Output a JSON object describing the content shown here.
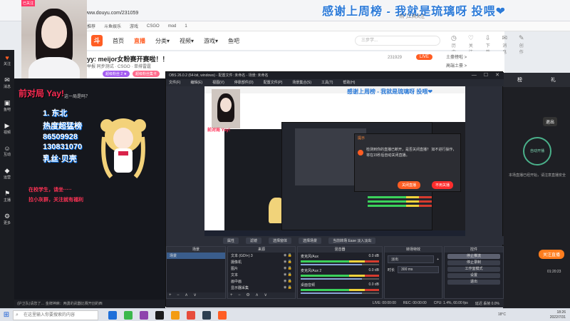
{
  "browser": {
    "url": "www.douyu.com/231059",
    "bookmarks": [
      "推荐",
      "斗鱼娱乐",
      "游戏",
      "CSGO",
      "mod",
      "1"
    ]
  },
  "banner": {
    "thanks_text": "感谢上周榜 - 我就是琉璃呀 投喂❤",
    "top_right_text": "热门工具关注"
  },
  "site": {
    "logo_text": "斗",
    "nav": [
      "首页",
      "直播",
      "分类▾",
      "视频▾",
      "游戏▾",
      "鱼吧"
    ],
    "active_nav_index": 1,
    "search_placeholder": "三步学...",
    "header_icons": [
      "历史",
      "关注",
      "下载",
      "消息",
      "创作"
    ]
  },
  "room": {
    "title": "yy: meijor女粉赛开赛啦！！",
    "subtitle": "举报  同步测试 · CSGO · 单排雷霆",
    "tags": [
      "超级粉丝 2 ★",
      "超级粉丝集卡"
    ],
    "room_id": "231929",
    "live_label": "LIVE",
    "webcam_badge": "已关注"
  },
  "gift_panel": {
    "items": [
      "土豪榜啦 >",
      "高端土豪 >"
    ]
  },
  "sidebar": {
    "items": [
      {
        "icon": "♥",
        "label": "关注",
        "icon_name": "heart-icon"
      },
      {
        "icon": "✉",
        "label": "消息",
        "icon_name": "mail-icon"
      },
      {
        "icon": "▣",
        "label": "鱼吧",
        "icon_name": "fishbar-icon"
      },
      {
        "icon": "▶",
        "label": "视频",
        "icon_name": "video-icon"
      },
      {
        "icon": "☺",
        "label": "互动",
        "icon_name": "smile-icon"
      },
      {
        "icon": "◆",
        "label": "运营",
        "icon_name": "diamond-icon"
      },
      {
        "icon": "⚑",
        "label": "主播",
        "icon_name": "flag-icon"
      },
      {
        "icon": "⚙",
        "label": "更多",
        "icon_name": "gear-icon"
      }
    ]
  },
  "stream": {
    "overlay_title": "前对局 Yay!",
    "question": "这一局是吗？",
    "ranking": [
      "1. 东北",
      "热度超猛榜",
      "86509928",
      "130831070",
      "乳丝·贝壳"
    ],
    "chat_lines": [
      "在校学生，请坐·····",
      "拉小灰群，关注就有福利"
    ],
    "bottom_bar": "(护卫队)请您了…  金牌神麻：两勇的武器比赛开创的西"
  },
  "right_panel": {
    "tab_left": "榜",
    "tab_right": "礼",
    "exit": "退出",
    "circle_label": "自动开播",
    "note": "本场直播已经开始，请注意直播安全",
    "live_button": "关注直播",
    "time": "01:20:23"
  },
  "obs": {
    "title": "OBS 26.0.2 (64-bit, windows) - 配置文件: 未命名 - 场景: 未命名",
    "menu": [
      "文件(F)",
      "编辑(E)",
      "视图(V)",
      "停靠部件(D)",
      "配置文件(P)",
      "场景集合(S)",
      "工具(T)",
      "帮助(H)"
    ],
    "win_controls": [
      "—",
      "☐",
      "✕"
    ],
    "preview": {
      "banner": "感谢上周榜 - 我就是琉璃呀 投喂❤",
      "red_text": "前对局 Yay!",
      "dialog_title": "提示",
      "dialog_text": "检测到你的直播已断开，是否关闭直播？ 如不进行操作，将在15秒后自动关闭直播。",
      "dialog_close_btn": "关闭直播",
      "dialog_noclose_btn": "不用关播"
    },
    "tabs": [
      "属性",
      "滤镜",
      "选择窗体",
      "选择场景",
      "当前转场 Ease 淡入淡出"
    ],
    "scene_label": "场景",
    "docks": {
      "scenes_title": "场景",
      "sources_title": "来源",
      "mixer_title": "混音器",
      "transitions_title": "转场特效",
      "controls_title": "控件"
    },
    "scenes": [
      "场景"
    ],
    "sources": [
      "文本 (GDI+) 3",
      "摄像机",
      "图片",
      "文本",
      "画中画",
      "显示器采集"
    ],
    "mixer_tracks": [
      {
        "name": "麦克风/Aux",
        "db": "0.0 dB",
        "level": 0.78
      },
      {
        "name": "麦克风/Aux 2",
        "db": "0.0 dB",
        "level": 0.78
      },
      {
        "name": "桌面音频",
        "db": "0.0 dB",
        "level": 0.78
      }
    ],
    "transition": {
      "type": "淡出",
      "duration_label": "时长",
      "duration": "300 ms"
    },
    "controls": [
      "停止推流",
      "停止录制",
      "工作室模式",
      "设置",
      "退出"
    ],
    "controls_hover_index": 0,
    "statusbar": [
      "LIVE: 00:00:00",
      "REC: 00:00:00",
      "CPU: 1.4%, 60.00 fps",
      "延迟 丢帧 0.0%"
    ]
  },
  "taskbar": {
    "start": "⊞",
    "search_placeholder": "在这里输入你要搜索的内容",
    "apps": [
      "#1e6fd9",
      "#3bb84a",
      "#8e44ad",
      "#1b1b1b",
      "#f39c12",
      "#e74c3c",
      "#2c3e50",
      "#ff5d23"
    ],
    "temp": "18°C",
    "time": "18:26",
    "date": "2022/7/31"
  }
}
